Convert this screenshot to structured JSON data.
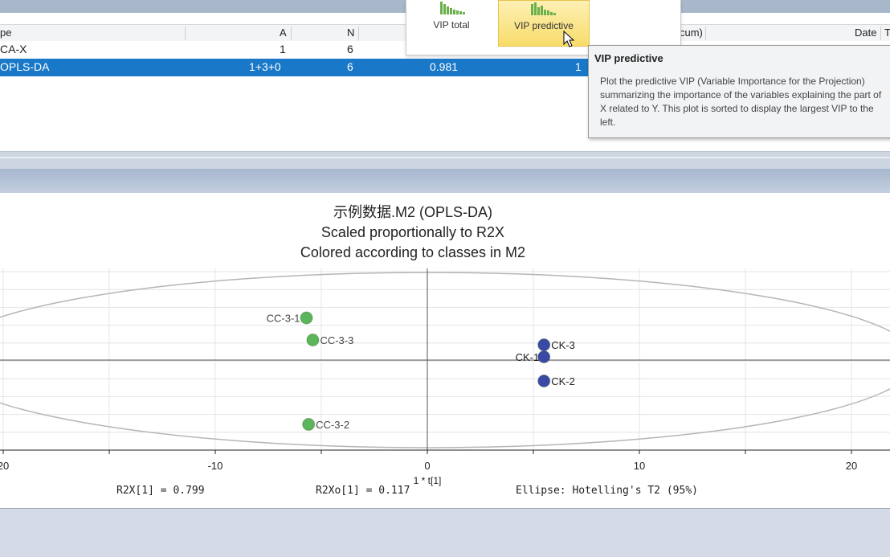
{
  "table": {
    "headers": {
      "type": "pe",
      "a": "A",
      "n": "N",
      "cum": "cum)",
      "date": "Date",
      "t": "T"
    },
    "rows": [
      {
        "type": "CA-X",
        "a": "1",
        "n": "6",
        "r2": "",
        "q2": ""
      },
      {
        "type": "OPLS-DA",
        "a": "1+3+0",
        "n": "6",
        "r2": "0.981",
        "q2": "1"
      }
    ]
  },
  "ribbon": {
    "buttons": [
      {
        "label": "VIP total",
        "highlighted": false
      },
      {
        "label": "VIP predictive",
        "highlighted": true
      }
    ]
  },
  "tooltip": {
    "title": "VIP predictive",
    "body": "Plot the predictive VIP (Variable Importance for the Projection) summarizing the importance of the variables explaining the part of X related to Y. This plot is sorted to display the largest VIP to the left."
  },
  "plot": {
    "title": "示例数据.M2 (OPLS-DA)",
    "subtitle1": "Scaled proportionally to R2X",
    "subtitle2": "Colored according to classes in M2",
    "xlabel": "1 * t[1]",
    "stats": {
      "r2x": "R2X[1] = 0.799",
      "r2xo": "R2Xo[1] = 0.117",
      "ellipse": "Ellipse: Hotelling's T2 (95%)"
    }
  },
  "chart_data": {
    "type": "scatter",
    "xlim": [
      -20,
      21
    ],
    "ylim": [
      -4,
      4
    ],
    "xticks": [
      -20,
      -10,
      0,
      10,
      20
    ],
    "xtick_labels": [
      "20",
      "-10",
      "0",
      "10",
      "20"
    ],
    "grid": true,
    "colors": {
      "CC": "#5cb55a",
      "CK": "#3b49a6"
    },
    "points": [
      {
        "label": "CC-3-1",
        "x": -5.7,
        "y": 1.05,
        "group": "CC"
      },
      {
        "label": "CC-3-3",
        "x": -5.4,
        "y": 0.5,
        "group": "CC"
      },
      {
        "label": "CC-3-2",
        "x": -5.6,
        "y": -1.6,
        "group": "CC"
      },
      {
        "label": "CK-1",
        "x": 5.5,
        "y": 0.08,
        "group": "CK"
      },
      {
        "label": "CK-3",
        "x": 5.5,
        "y": 0.38,
        "group": "CK"
      },
      {
        "label": "CK-2",
        "x": 5.5,
        "y": -0.52,
        "group": "CK"
      }
    ]
  }
}
